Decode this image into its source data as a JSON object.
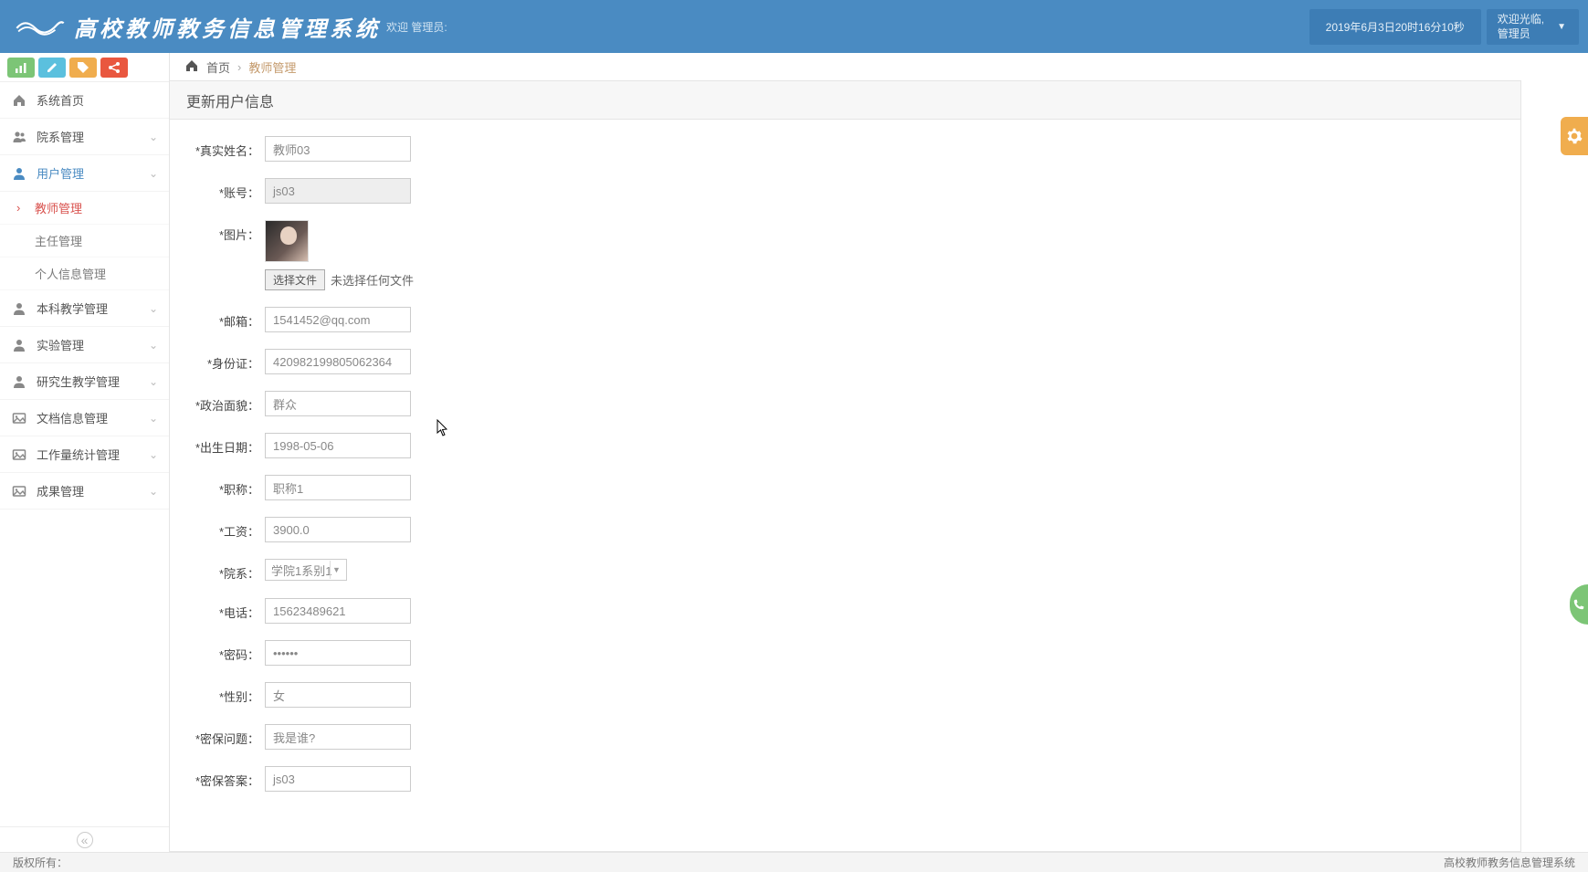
{
  "header": {
    "app_title": "高校教师教务信息管理系统",
    "welcome": "欢迎 管理员:",
    "datetime": "2019年6月3日20时16分10秒",
    "user_line1": "欢迎光临,",
    "user_line2": "管理员"
  },
  "sidebar": {
    "items": [
      {
        "icon": "home",
        "label": "系统首页",
        "expandable": false
      },
      {
        "icon": "users",
        "label": "院系管理",
        "expandable": true
      },
      {
        "icon": "user",
        "label": "用户管理",
        "expandable": true,
        "active": true,
        "children": [
          {
            "label": "教师管理",
            "active": true
          },
          {
            "label": "主任管理"
          },
          {
            "label": "个人信息管理"
          }
        ]
      },
      {
        "icon": "user",
        "label": "本科教学管理",
        "expandable": true
      },
      {
        "icon": "user",
        "label": "实验管理",
        "expandable": true
      },
      {
        "icon": "user",
        "label": "研究生教学管理",
        "expandable": true
      },
      {
        "icon": "image",
        "label": "文档信息管理",
        "expandable": true
      },
      {
        "icon": "image",
        "label": "工作量统计管理",
        "expandable": true
      },
      {
        "icon": "image",
        "label": "成果管理",
        "expandable": true
      }
    ]
  },
  "breadcrumb": {
    "home": "首页",
    "current": "教师管理"
  },
  "panel": {
    "title": "更新用户信息"
  },
  "form": {
    "fields": {
      "realname": {
        "label": "*真实姓名：",
        "value": "教师03"
      },
      "account": {
        "label": "*账号：",
        "value": "js03"
      },
      "picture": {
        "label": "*图片：",
        "choose_btn": "选择文件",
        "status": "未选择任何文件"
      },
      "email": {
        "label": "*邮箱：",
        "value": "1541452@qq.com"
      },
      "idcard": {
        "label": "*身份证：",
        "value": "420982199805062364"
      },
      "politics": {
        "label": "*政治面貌：",
        "value": "群众"
      },
      "birth": {
        "label": "*出生日期：",
        "value": "1998-05-06"
      },
      "title": {
        "label": "*职称：",
        "value": "职称1"
      },
      "salary": {
        "label": "*工资：",
        "value": "3900.0"
      },
      "dept": {
        "label": "*院系：",
        "value": "学院1系别1"
      },
      "phone": {
        "label": "*电话：",
        "value": "15623489621"
      },
      "password": {
        "label": "*密码：",
        "value": "••••••"
      },
      "gender": {
        "label": "*性别：",
        "value": "女"
      },
      "secq": {
        "label": "*密保问题：",
        "value": "我是谁?"
      },
      "seca": {
        "label": "*密保答案：",
        "value": "js03"
      }
    }
  },
  "footer": {
    "left": "版权所有：",
    "right": "高校教师教务信息管理系统"
  }
}
